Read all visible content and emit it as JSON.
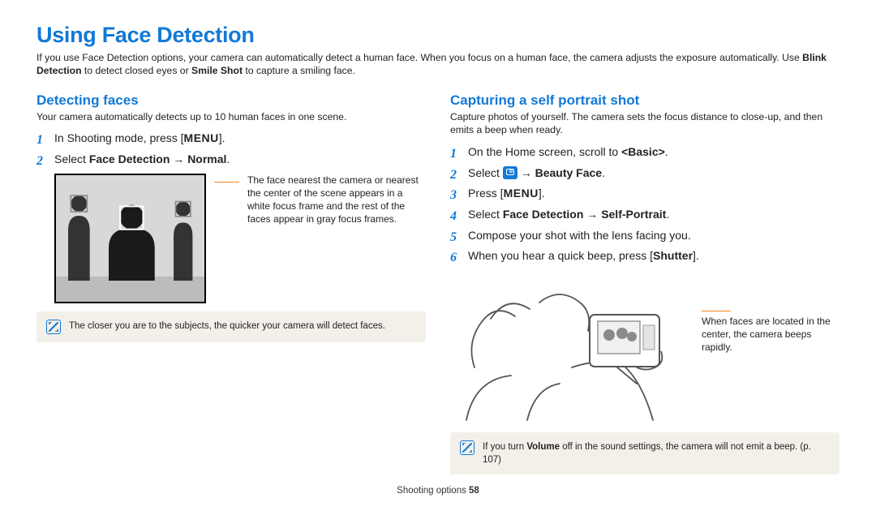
{
  "title": "Using Face Detection",
  "intro_parts": {
    "p1": "If you use Face Detection options, your camera can automatically detect a human face. When you focus on a human face, the camera adjusts the exposure automatically. Use ",
    "b1": "Blink Detection",
    "p2": " to detect closed eyes or ",
    "b2": "Smile Shot",
    "p3": " to capture a smiling face."
  },
  "left": {
    "heading": "Detecting faces",
    "lede": "Your camera automatically detects up to 10 human faces in one scene.",
    "step1_a": "In Shooting mode, press [",
    "step1_key": "MENU",
    "step1_b": "].",
    "step2_a": "Select ",
    "step2_b": "Face Detection",
    "step2_c": " → ",
    "step2_d": "Normal",
    "step2_e": ".",
    "caption": "The face nearest the camera or nearest the center of the scene appears in a white focus frame and the rest of the faces appear in gray focus frames.",
    "tip": "The closer you are to the subjects, the quicker your camera will detect faces."
  },
  "right": {
    "heading": "Capturing a self portrait shot",
    "lede": "Capture photos of yourself. The camera sets the focus distance to close-up, and then emits a beep when ready.",
    "s1_a": "On the Home screen, scroll to ",
    "s1_b": "<Basic>",
    "s1_c": ".",
    "s2_a": "Select ",
    "s2_b": " → ",
    "s2_c": "Beauty Face",
    "s2_d": ".",
    "s3_a": "Press [",
    "s3_key": "MENU",
    "s3_b": "].",
    "s4_a": "Select ",
    "s4_b": "Face Detection",
    "s4_c": " → ",
    "s4_d": "Self-Portrait",
    "s4_e": ".",
    "s5": "Compose your shot with the lens facing you.",
    "s6_a": "When you hear a quick beep, press [",
    "s6_b": "Shutter",
    "s6_c": "].",
    "caption": "When faces are located in the center, the camera beeps rapidly.",
    "tip_a": "If you turn ",
    "tip_b": "Volume",
    "tip_c": " off in the sound settings, the camera will not emit a beep. (p. 107)"
  },
  "footer_a": "Shooting options  ",
  "footer_b": "58"
}
